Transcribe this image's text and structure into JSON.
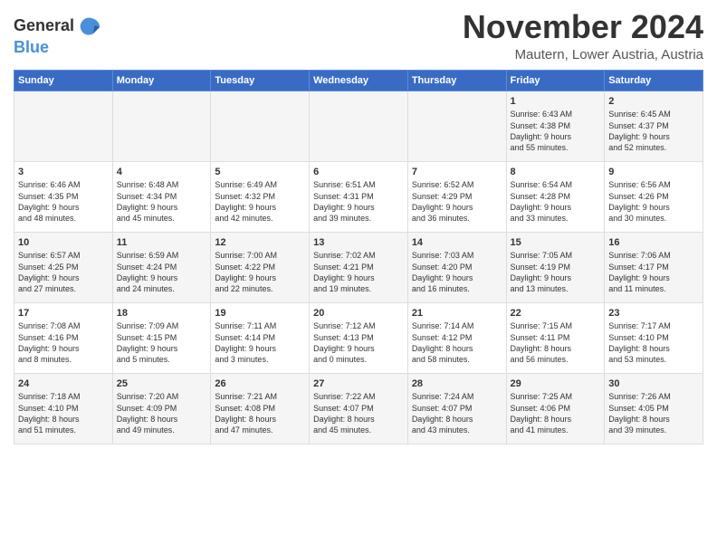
{
  "header": {
    "logo_line1": "General",
    "logo_line2": "Blue",
    "month_title": "November 2024",
    "location": "Mautern, Lower Austria, Austria"
  },
  "weekdays": [
    "Sunday",
    "Monday",
    "Tuesday",
    "Wednesday",
    "Thursday",
    "Friday",
    "Saturday"
  ],
  "weeks": [
    [
      {
        "day": "",
        "content": ""
      },
      {
        "day": "",
        "content": ""
      },
      {
        "day": "",
        "content": ""
      },
      {
        "day": "",
        "content": ""
      },
      {
        "day": "",
        "content": ""
      },
      {
        "day": "1",
        "content": "Sunrise: 6:43 AM\nSunset: 4:38 PM\nDaylight: 9 hours\nand 55 minutes."
      },
      {
        "day": "2",
        "content": "Sunrise: 6:45 AM\nSunset: 4:37 PM\nDaylight: 9 hours\nand 52 minutes."
      }
    ],
    [
      {
        "day": "3",
        "content": "Sunrise: 6:46 AM\nSunset: 4:35 PM\nDaylight: 9 hours\nand 48 minutes."
      },
      {
        "day": "4",
        "content": "Sunrise: 6:48 AM\nSunset: 4:34 PM\nDaylight: 9 hours\nand 45 minutes."
      },
      {
        "day": "5",
        "content": "Sunrise: 6:49 AM\nSunset: 4:32 PM\nDaylight: 9 hours\nand 42 minutes."
      },
      {
        "day": "6",
        "content": "Sunrise: 6:51 AM\nSunset: 4:31 PM\nDaylight: 9 hours\nand 39 minutes."
      },
      {
        "day": "7",
        "content": "Sunrise: 6:52 AM\nSunset: 4:29 PM\nDaylight: 9 hours\nand 36 minutes."
      },
      {
        "day": "8",
        "content": "Sunrise: 6:54 AM\nSunset: 4:28 PM\nDaylight: 9 hours\nand 33 minutes."
      },
      {
        "day": "9",
        "content": "Sunrise: 6:56 AM\nSunset: 4:26 PM\nDaylight: 9 hours\nand 30 minutes."
      }
    ],
    [
      {
        "day": "10",
        "content": "Sunrise: 6:57 AM\nSunset: 4:25 PM\nDaylight: 9 hours\nand 27 minutes."
      },
      {
        "day": "11",
        "content": "Sunrise: 6:59 AM\nSunset: 4:24 PM\nDaylight: 9 hours\nand 24 minutes."
      },
      {
        "day": "12",
        "content": "Sunrise: 7:00 AM\nSunset: 4:22 PM\nDaylight: 9 hours\nand 22 minutes."
      },
      {
        "day": "13",
        "content": "Sunrise: 7:02 AM\nSunset: 4:21 PM\nDaylight: 9 hours\nand 19 minutes."
      },
      {
        "day": "14",
        "content": "Sunrise: 7:03 AM\nSunset: 4:20 PM\nDaylight: 9 hours\nand 16 minutes."
      },
      {
        "day": "15",
        "content": "Sunrise: 7:05 AM\nSunset: 4:19 PM\nDaylight: 9 hours\nand 13 minutes."
      },
      {
        "day": "16",
        "content": "Sunrise: 7:06 AM\nSunset: 4:17 PM\nDaylight: 9 hours\nand 11 minutes."
      }
    ],
    [
      {
        "day": "17",
        "content": "Sunrise: 7:08 AM\nSunset: 4:16 PM\nDaylight: 9 hours\nand 8 minutes."
      },
      {
        "day": "18",
        "content": "Sunrise: 7:09 AM\nSunset: 4:15 PM\nDaylight: 9 hours\nand 5 minutes."
      },
      {
        "day": "19",
        "content": "Sunrise: 7:11 AM\nSunset: 4:14 PM\nDaylight: 9 hours\nand 3 minutes."
      },
      {
        "day": "20",
        "content": "Sunrise: 7:12 AM\nSunset: 4:13 PM\nDaylight: 9 hours\nand 0 minutes."
      },
      {
        "day": "21",
        "content": "Sunrise: 7:14 AM\nSunset: 4:12 PM\nDaylight: 8 hours\nand 58 minutes."
      },
      {
        "day": "22",
        "content": "Sunrise: 7:15 AM\nSunset: 4:11 PM\nDaylight: 8 hours\nand 56 minutes."
      },
      {
        "day": "23",
        "content": "Sunrise: 7:17 AM\nSunset: 4:10 PM\nDaylight: 8 hours\nand 53 minutes."
      }
    ],
    [
      {
        "day": "24",
        "content": "Sunrise: 7:18 AM\nSunset: 4:10 PM\nDaylight: 8 hours\nand 51 minutes."
      },
      {
        "day": "25",
        "content": "Sunrise: 7:20 AM\nSunset: 4:09 PM\nDaylight: 8 hours\nand 49 minutes."
      },
      {
        "day": "26",
        "content": "Sunrise: 7:21 AM\nSunset: 4:08 PM\nDaylight: 8 hours\nand 47 minutes."
      },
      {
        "day": "27",
        "content": "Sunrise: 7:22 AM\nSunset: 4:07 PM\nDaylight: 8 hours\nand 45 minutes."
      },
      {
        "day": "28",
        "content": "Sunrise: 7:24 AM\nSunset: 4:07 PM\nDaylight: 8 hours\nand 43 minutes."
      },
      {
        "day": "29",
        "content": "Sunrise: 7:25 AM\nSunset: 4:06 PM\nDaylight: 8 hours\nand 41 minutes."
      },
      {
        "day": "30",
        "content": "Sunrise: 7:26 AM\nSunset: 4:05 PM\nDaylight: 8 hours\nand 39 minutes."
      }
    ]
  ]
}
